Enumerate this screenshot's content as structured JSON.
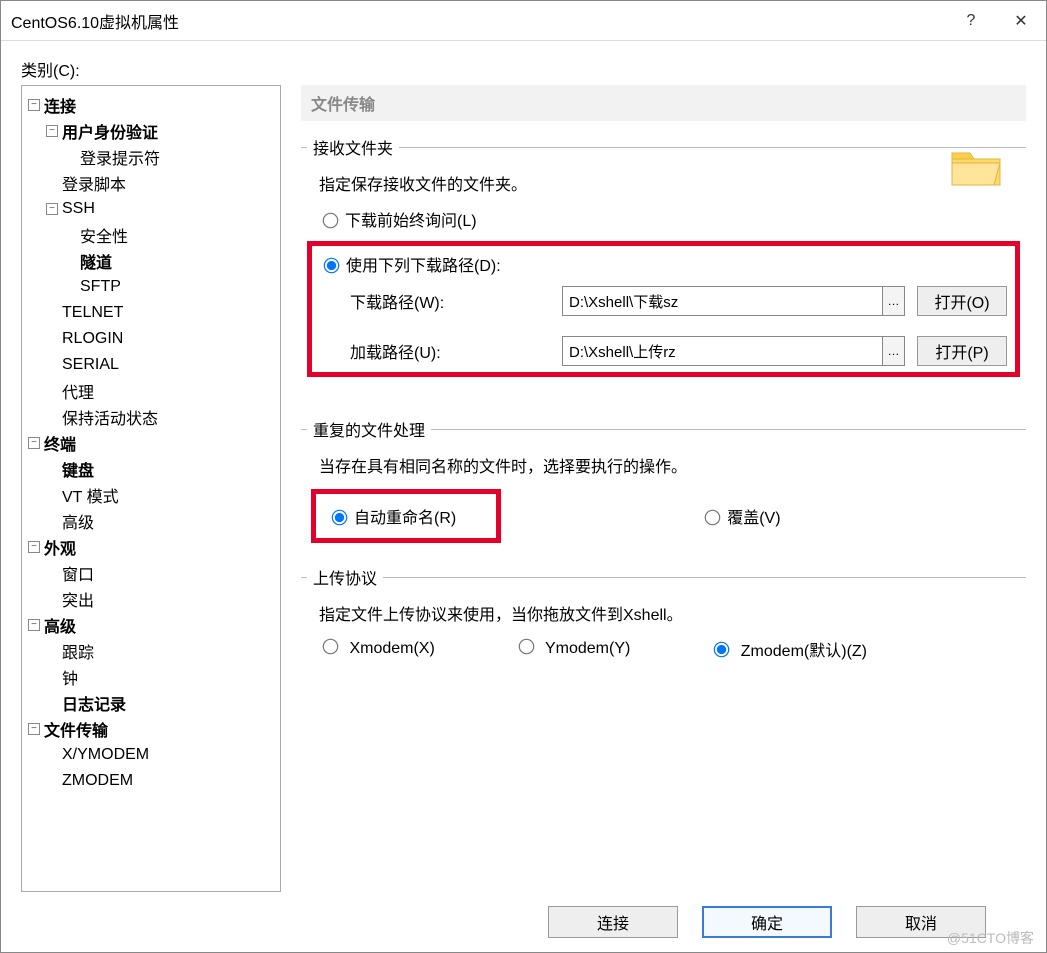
{
  "window": {
    "title": "CentOS6.10虚拟机属性",
    "help": "?",
    "close": "✕"
  },
  "category_label": "类别(C):",
  "tree": {
    "connection": "连接",
    "auth": "用户身份验证",
    "login_prompt": "登录提示符",
    "login_script": "登录脚本",
    "ssh": "SSH",
    "security": "安全性",
    "tunnel": "隧道",
    "sftp": "SFTP",
    "telnet": "TELNET",
    "rlogin": "RLOGIN",
    "serial": "SERIAL",
    "proxy": "代理",
    "keepalive": "保持活动状态",
    "terminal": "终端",
    "keyboard": "键盘",
    "vt": "VT 模式",
    "advanced_term": "高级",
    "appearance": "外观",
    "window_item": "窗口",
    "highlight": "突出",
    "advanced": "高级",
    "trace": "跟踪",
    "bell": "钟",
    "logging": "日志记录",
    "filetransfer": "文件传输",
    "xymodem": "X/YMODEM",
    "zmodem": "ZMODEM"
  },
  "panel": {
    "header": "文件传输",
    "recv_folder_legend": "接收文件夹",
    "recv_folder_desc": "指定保存接收文件的文件夹。",
    "ask_always_label": "下载前始终询问(L)",
    "use_path_label": "使用下列下载路径(D):",
    "download_label": "下载路径(W):",
    "download_value": "D:\\Xshell\\下载sz",
    "upload_label": "加载路径(U):",
    "upload_value": "D:\\Xshell\\上传rz",
    "open_d": "打开(O)",
    "open_u": "打开(P)",
    "dup_legend": "重复的文件处理",
    "dup_desc": "当存在具有相同名称的文件时，选择要执行的操作。",
    "dup_auto": "自动重命名(R)",
    "dup_over": "覆盖(V)",
    "upload_proto_legend": "上传协议",
    "upload_proto_desc": "指定文件上传协议来使用，当你拖放文件到Xshell。",
    "proto_x": "Xmodem(X)",
    "proto_y": "Ymodem(Y)",
    "proto_z": "Zmodem(默认)(Z)"
  },
  "buttons": {
    "connect": "连接",
    "ok": "确定",
    "cancel": "取消"
  },
  "watermark": "@51CTO博客"
}
